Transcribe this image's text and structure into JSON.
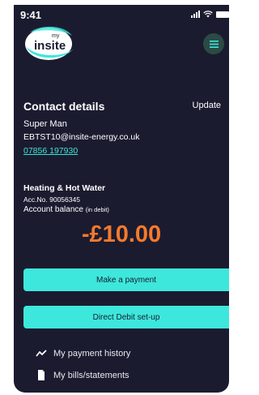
{
  "status_bar": {
    "time": "9:41"
  },
  "logo": {
    "small_text": "my",
    "brand": "insite"
  },
  "contact": {
    "title": "Contact details",
    "update_label": "Update",
    "name": "Super Man",
    "email": "EBTST10@insite-energy.co.uk",
    "phone": "07856 197930"
  },
  "account": {
    "title": "Heating & Hot Water",
    "number": "Acc.No. 90056345",
    "balance_label": "Account balance",
    "balance_note": "(in debit)",
    "balance_value": "-£10.00"
  },
  "actions": {
    "make_payment": "Make a payment",
    "direct_debit": "Direct Debit set-up"
  },
  "links": {
    "payment_history": "My payment history",
    "bills": "My bills/statements"
  },
  "colors": {
    "background": "#1b1b30",
    "accent": "#3de7dc",
    "balance": "#f47a2c"
  }
}
